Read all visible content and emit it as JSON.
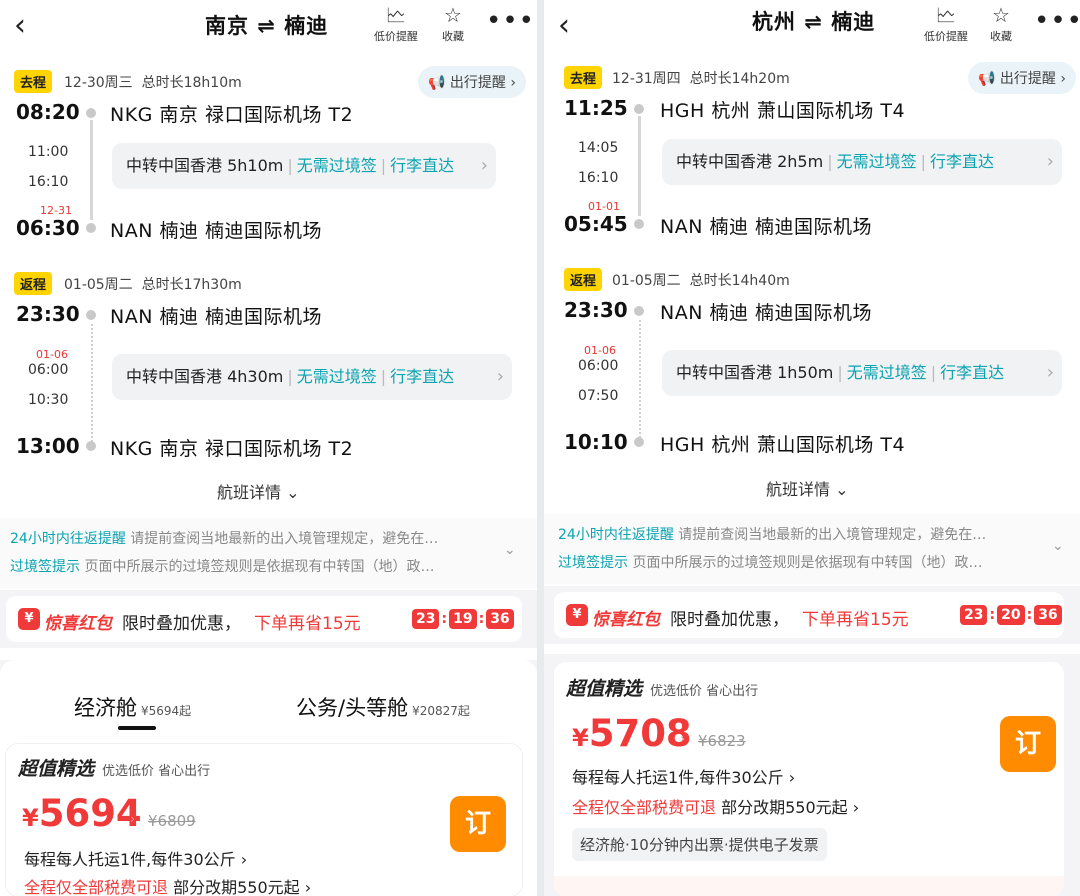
{
  "left": {
    "route": "南京 ⇌ 楠迪",
    "header_btns": {
      "low_price": "低价提醒",
      "favorite": "收藏"
    },
    "outbound": {
      "tag": "去程",
      "date": "12-30周三",
      "duration": "总时长18h10m",
      "remind": "出行提醒",
      "dep_time": "08:20",
      "dep_airport": "NKG  南京  禄口国际机场  T2",
      "transfer_arr": "11:00",
      "transfer_dep": "16:10",
      "transfer_city": "中转中国香港 5h10m",
      "tag_visa": "无需过境签",
      "tag_bag": "行李直达",
      "arr_date": "12-31",
      "arr_time": "06:30",
      "arr_airport": "NAN  楠迪  楠迪国际机场"
    },
    "return": {
      "tag": "返程",
      "date": "01-05周二",
      "duration": "总时长17h30m",
      "dep_time": "23:30",
      "dep_airport": "NAN  楠迪  楠迪国际机场",
      "transfer_date": "01-06",
      "transfer_arr": "06:00",
      "transfer_dep": "10:30",
      "transfer_city": "中转中国香港 4h30m",
      "tag_visa": "无需过境签",
      "tag_bag": "行李直达",
      "arr_time": "13:00",
      "arr_airport": "NKG  南京  禄口国际机场  T2"
    },
    "detail": "航班详情",
    "notice1_label": "24小时内往返提醒",
    "notice1_text": "请提前查阅当地最新的出入境管理规定，避免在…",
    "notice2_label": "过境签提示",
    "notice2_text": "页面中所展示的过境签规则是依据现有中转国（地）政…",
    "hb_title": "惊喜红包",
    "hb_desc": "限时叠加优惠，",
    "hb_red": "下单再省15元",
    "countdown": [
      "23",
      "19",
      "36"
    ],
    "cabin_eco": "经济舱",
    "cabin_eco_price": "¥5694起",
    "cabin_biz": "公务/头等舱",
    "cabin_biz_price": "¥20827起",
    "sel_title": "超值精选",
    "sel_sub": "优选低价  省心出行",
    "yen": "¥",
    "price": "5694",
    "orig_price": "¥6809",
    "line1": "每程每人托运1件,每件30公斤",
    "line2_red": "全程仅全部税费可退",
    "line2": "部分改期550元起",
    "book": "订"
  },
  "right": {
    "route": "杭州 ⇌ 楠迪",
    "header_btns": {
      "low_price": "低价提醒",
      "favorite": "收藏"
    },
    "outbound": {
      "tag": "去程",
      "date": "12-31周四",
      "duration": "总时长14h20m",
      "remind": "出行提醒",
      "dep_time": "11:25",
      "dep_airport": "HGH  杭州  萧山国际机场  T4",
      "transfer_arr": "14:05",
      "transfer_dep": "16:10",
      "transfer_city": "中转中国香港 2h5m",
      "tag_visa": "无需过境签",
      "tag_bag": "行李直达",
      "arr_date": "01-01",
      "arr_time": "05:45",
      "arr_airport": "NAN  楠迪  楠迪国际机场"
    },
    "return": {
      "tag": "返程",
      "date": "01-05周二",
      "duration": "总时长14h40m",
      "dep_time": "23:30",
      "dep_airport": "NAN  楠迪  楠迪国际机场",
      "transfer_date": "01-06",
      "transfer_arr": "06:00",
      "transfer_dep": "07:50",
      "transfer_city": "中转中国香港 1h50m",
      "tag_visa": "无需过境签",
      "tag_bag": "行李直达",
      "arr_time": "10:10",
      "arr_airport": "HGH  杭州  萧山国际机场  T4"
    },
    "detail": "航班详情",
    "notice1_label": "24小时内往返提醒",
    "notice1_text": "请提前查阅当地最新的出入境管理规定，避免在…",
    "notice2_label": "过境签提示",
    "notice2_text": "页面中所展示的过境签规则是依据现有中转国（地）政…",
    "hb_title": "惊喜红包",
    "hb_desc": "限时叠加优惠，",
    "hb_red": "下单再省15元",
    "countdown": [
      "23",
      "20",
      "36"
    ],
    "sel_title": "超值精选",
    "sel_sub": "优选低价  省心出行",
    "yen": "¥",
    "price": "5708",
    "orig_price": "¥6823",
    "line1": "每程每人托运1件,每件30公斤",
    "line2_red": "全程仅全部税费可退",
    "line2": "部分改期550元起",
    "chip": "经济舱·10分钟内出票·提供电子发票",
    "book": "订"
  },
  "colors": {
    "accent_red": "#f03a3a",
    "teal": "#0aa3b0",
    "tag_yellow": "#ffd400",
    "book_orange": "#ff8b00"
  }
}
